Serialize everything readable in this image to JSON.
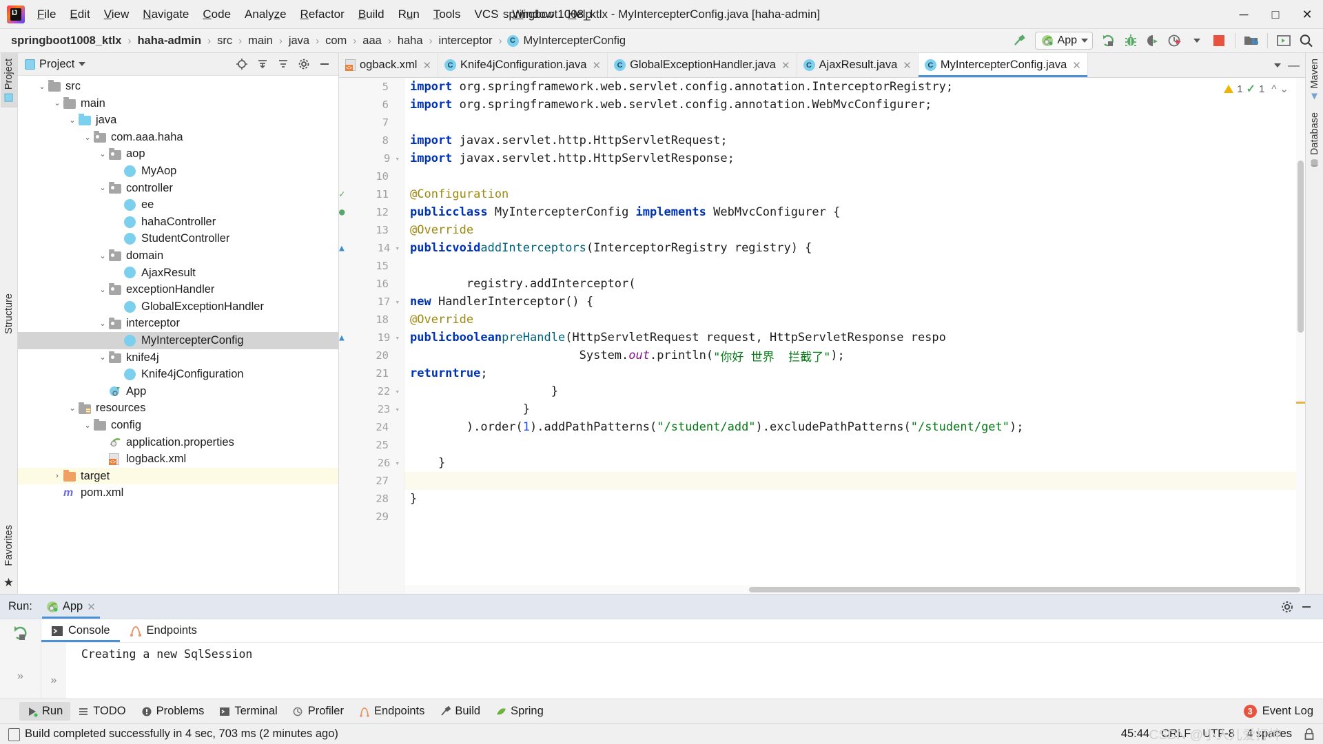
{
  "window": {
    "title": "springboot1008_ktlx - MyIntercepterConfig.java [haha-admin]",
    "minimize": "─",
    "maximize": "□",
    "close": "✕"
  },
  "menubar": [
    {
      "label": "File",
      "mnemonic": "F"
    },
    {
      "label": "Edit",
      "mnemonic": "E"
    },
    {
      "label": "View",
      "mnemonic": "V"
    },
    {
      "label": "Navigate",
      "mnemonic": "N"
    },
    {
      "label": "Code",
      "mnemonic": "C"
    },
    {
      "label": "Analyze",
      "mnemonic": "z"
    },
    {
      "label": "Refactor",
      "mnemonic": "R"
    },
    {
      "label": "Build",
      "mnemonic": "B"
    },
    {
      "label": "Run",
      "mnemonic": "u"
    },
    {
      "label": "Tools",
      "mnemonic": "T"
    },
    {
      "label": "VCS",
      "mnemonic": ""
    },
    {
      "label": "Window",
      "mnemonic": "W"
    },
    {
      "label": "Help",
      "mnemonic": "H"
    }
  ],
  "navbar": {
    "crumbs": [
      {
        "label": "springboot1008_ktlx",
        "bold": true
      },
      {
        "label": "haha-admin",
        "bold": true
      },
      {
        "label": "src",
        "bold": false
      },
      {
        "label": "main",
        "bold": false
      },
      {
        "label": "java",
        "bold": false
      },
      {
        "label": "com",
        "bold": false
      },
      {
        "label": "aaa",
        "bold": false
      },
      {
        "label": "haha",
        "bold": false
      },
      {
        "label": "interceptor",
        "bold": false
      },
      {
        "label": "MyIntercepterConfig",
        "bold": false,
        "badge": "C"
      }
    ],
    "separator": "›",
    "run_config": "App",
    "icons": [
      "build-hammer-icon",
      "run-icon",
      "debug-icon",
      "run-with-coverage-icon",
      "profiler-icon",
      "stop-icon",
      "project-structure-icon",
      "terminal-icon",
      "search-icon"
    ]
  },
  "sidebar_left": {
    "tabs": [
      "Project",
      "Structure",
      "Favorites"
    ]
  },
  "sidebar_right": {
    "tabs": [
      "Maven",
      "Database"
    ]
  },
  "project_panel": {
    "title": "Project",
    "actions": [
      "locate-icon",
      "collapse-all-icon",
      "expand-all-icon",
      "settings-gear-icon",
      "hide-icon"
    ],
    "tree": [
      {
        "label": "src",
        "indent": 2,
        "icon": "folder",
        "twist": "⌄",
        "state": ""
      },
      {
        "label": "main",
        "indent": 3,
        "icon": "folder",
        "twist": "⌄",
        "state": ""
      },
      {
        "label": "java",
        "indent": 4,
        "icon": "folder-blue",
        "twist": "⌄",
        "state": ""
      },
      {
        "label": "com.aaa.haha",
        "indent": 5,
        "icon": "folder-pkg",
        "twist": "⌄",
        "state": ""
      },
      {
        "label": "aop",
        "indent": 6,
        "icon": "folder-pkg",
        "twist": "⌄",
        "state": ""
      },
      {
        "label": "MyAop",
        "indent": 7,
        "icon": "class",
        "twist": "",
        "state": ""
      },
      {
        "label": "controller",
        "indent": 6,
        "icon": "folder-pkg",
        "twist": "⌄",
        "state": ""
      },
      {
        "label": "ee",
        "indent": 7,
        "icon": "class",
        "twist": "",
        "state": ""
      },
      {
        "label": "hahaController",
        "indent": 7,
        "icon": "class",
        "twist": "",
        "state": ""
      },
      {
        "label": "StudentController",
        "indent": 7,
        "icon": "class",
        "twist": "",
        "state": ""
      },
      {
        "label": "domain",
        "indent": 6,
        "icon": "folder-pkg",
        "twist": "⌄",
        "state": ""
      },
      {
        "label": "AjaxResult",
        "indent": 7,
        "icon": "class",
        "twist": "",
        "state": ""
      },
      {
        "label": "exceptionHandler",
        "indent": 6,
        "icon": "folder-pkg",
        "twist": "⌄",
        "state": ""
      },
      {
        "label": "GlobalExceptionHandler",
        "indent": 7,
        "icon": "class",
        "twist": "",
        "state": ""
      },
      {
        "label": "interceptor",
        "indent": 6,
        "icon": "folder-pkg",
        "twist": "⌄",
        "state": ""
      },
      {
        "label": "MyIntercepterConfig",
        "indent": 7,
        "icon": "class",
        "twist": "",
        "state": "selected"
      },
      {
        "label": "knife4j",
        "indent": 6,
        "icon": "folder-pkg",
        "twist": "⌄",
        "state": ""
      },
      {
        "label": "Knife4jConfiguration",
        "indent": 7,
        "icon": "class",
        "twist": "",
        "state": ""
      },
      {
        "label": "App",
        "indent": 6,
        "icon": "spring-class",
        "twist": "",
        "state": ""
      },
      {
        "label": "resources",
        "indent": 4,
        "icon": "folder-res",
        "twist": "⌄",
        "state": ""
      },
      {
        "label": "config",
        "indent": 5,
        "icon": "folder",
        "twist": "⌄",
        "state": ""
      },
      {
        "label": "application.properties",
        "indent": 6,
        "icon": "spring-props",
        "twist": "",
        "state": ""
      },
      {
        "label": "logback.xml",
        "indent": 6,
        "icon": "xml",
        "twist": "",
        "state": ""
      },
      {
        "label": "target",
        "indent": 3,
        "icon": "folder-orange",
        "twist": "›",
        "state": "highlight"
      },
      {
        "label": "pom.xml",
        "indent": 3,
        "icon": "maven",
        "twist": "",
        "state": ""
      }
    ]
  },
  "editor": {
    "tabs": [
      {
        "label": "ogback.xml",
        "icon": "xml-icon",
        "active": false,
        "closable": true
      },
      {
        "label": "Knife4jConfiguration.java",
        "icon": "class-icon",
        "active": false,
        "closable": true
      },
      {
        "label": "GlobalExceptionHandler.java",
        "icon": "class-icon",
        "active": false,
        "closable": true
      },
      {
        "label": "AjaxResult.java",
        "icon": "class-icon",
        "active": false,
        "closable": true
      },
      {
        "label": "MyIntercepterConfig.java",
        "icon": "class-icon",
        "active": true,
        "closable": true
      }
    ],
    "inspections": {
      "warnings": "1",
      "checks": "1"
    },
    "first_line_number": 5,
    "lines": [
      {
        "n": 5,
        "text": "import org.springframework.web.servlet.config.annotation.InterceptorRegistry;",
        "kind": "import",
        "cut_top": true
      },
      {
        "n": 6,
        "text": "import org.springframework.web.servlet.config.annotation.WebMvcConfigurer;",
        "kind": "import"
      },
      {
        "n": 7,
        "text": "",
        "kind": "blank"
      },
      {
        "n": 8,
        "text": "import javax.servlet.http.HttpServletRequest;",
        "kind": "import"
      },
      {
        "n": 9,
        "text": "import javax.servlet.http.HttpServletResponse;",
        "kind": "import",
        "fold": true
      },
      {
        "n": 10,
        "text": "",
        "kind": "blank"
      },
      {
        "n": 11,
        "text": "@Configuration",
        "kind": "annotation",
        "gutter_icon": "bean-icon"
      },
      {
        "n": 12,
        "text": "public class MyIntercepterConfig implements WebMvcConfigurer {",
        "kind": "classdecl",
        "gutter_icon": "spring-bean-icon"
      },
      {
        "n": 13,
        "text": "    @Override",
        "kind": "annotation"
      },
      {
        "n": 14,
        "text": "    public void addInterceptors(InterceptorRegistry registry) {",
        "kind": "method",
        "gutter_icon": "override-icon",
        "fold": true
      },
      {
        "n": 15,
        "text": "",
        "kind": "blank"
      },
      {
        "n": 16,
        "text": "        registry.addInterceptor(",
        "kind": "code"
      },
      {
        "n": 17,
        "text": "                new HandlerInterceptor() {",
        "kind": "code",
        "fold": true
      },
      {
        "n": 18,
        "text": "                    @Override",
        "kind": "annotation"
      },
      {
        "n": 19,
        "text": "                    public boolean preHandle(HttpServletRequest request, HttpServletResponse respo",
        "kind": "method",
        "gutter_icon": "override-icon",
        "fold": true
      },
      {
        "n": 20,
        "text": "                        System.out.println(\"你好 世界  拦截了\");",
        "kind": "code"
      },
      {
        "n": 21,
        "text": "                        return true;",
        "kind": "code"
      },
      {
        "n": 22,
        "text": "                    }",
        "kind": "code",
        "fold": true
      },
      {
        "n": 23,
        "text": "                }",
        "kind": "code",
        "fold": true
      },
      {
        "n": 24,
        "text": "        ).order(1).addPathPatterns(\"/student/add\").excludePathPatterns(\"/student/get\");",
        "kind": "code"
      },
      {
        "n": 25,
        "text": "",
        "kind": "blank"
      },
      {
        "n": 26,
        "text": "    }",
        "kind": "code",
        "fold": true
      },
      {
        "n": 27,
        "text": "",
        "kind": "blank",
        "current": true
      },
      {
        "n": 28,
        "text": "}",
        "kind": "code"
      },
      {
        "n": 29,
        "text": "",
        "kind": "blank",
        "cut_bottom": true
      }
    ]
  },
  "run_panel": {
    "label": "Run:",
    "tab": "App",
    "tab_close": "✕",
    "subtabs": [
      {
        "label": "Console",
        "icon": "console-icon",
        "active": true
      },
      {
        "label": "Endpoints",
        "icon": "endpoints-icon",
        "active": false
      }
    ],
    "side_actions": [
      "rerun-icon",
      "expand-more-icon",
      "expand-more-2-icon"
    ],
    "header_actions": [
      "settings-gear-icon",
      "hide-icon"
    ],
    "console_output": "Creating a new SqlSession"
  },
  "bottom_toolbar": {
    "items": [
      {
        "label": "Run",
        "icon": "run-icon",
        "active": true
      },
      {
        "label": "TODO",
        "icon": "todo-icon",
        "active": false
      },
      {
        "label": "Problems",
        "icon": "problems-icon",
        "active": false
      },
      {
        "label": "Terminal",
        "icon": "terminal-icon",
        "active": false
      },
      {
        "label": "Profiler",
        "icon": "profiler-icon",
        "active": false
      },
      {
        "label": "Endpoints",
        "icon": "endpoints-icon",
        "active": false
      },
      {
        "label": "Build",
        "icon": "build-icon",
        "active": false
      },
      {
        "label": "Spring",
        "icon": "spring-icon",
        "active": false
      }
    ],
    "event_log": {
      "label": "Event Log",
      "count": "3"
    }
  },
  "statusbar": {
    "message": "Build completed successfully in 4 sec, 703 ms (2 minutes ago)",
    "caret": "45:44",
    "line_separator": "CRLF",
    "encoding": "UTF-8",
    "indent": "4 spaces",
    "watermark": "CSDN @小人儿爱打坤"
  },
  "colors": {
    "accent_blue": "#4a90d9",
    "keyword": "#0033b3",
    "string": "#067d17",
    "annotation": "#9e880d",
    "class_badge": "#7dcfee",
    "spring_green": "#6db33f",
    "error_red": "#e8533f",
    "selection_gray": "#d4d4d4"
  }
}
